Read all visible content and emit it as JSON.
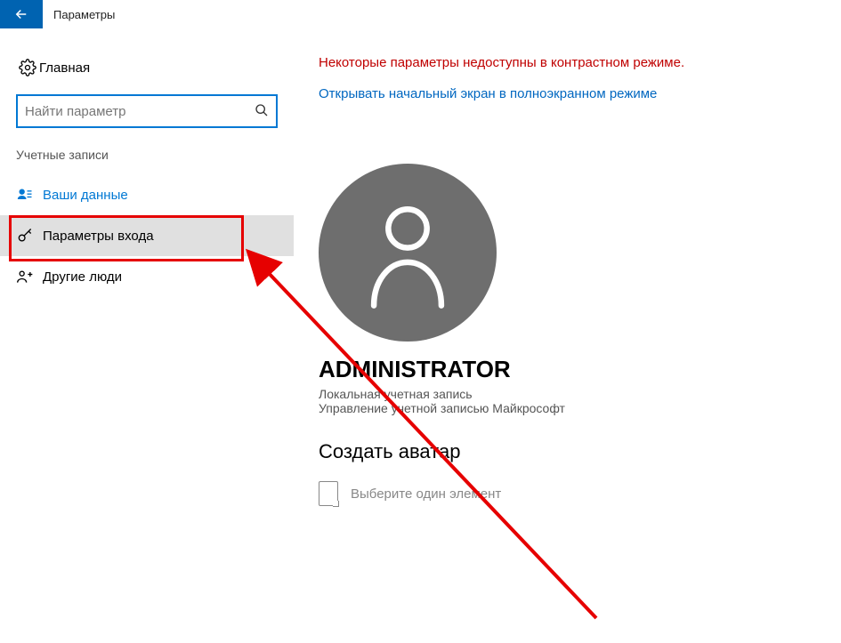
{
  "titlebar": {
    "title": "Параметры"
  },
  "sidebar": {
    "home": "Главная",
    "search_placeholder": "Найти параметр",
    "section": "Учетные записи",
    "items": [
      {
        "label": "Ваши данные"
      },
      {
        "label": "Параметры входа"
      },
      {
        "label": "Другие люди"
      }
    ]
  },
  "content": {
    "warning": "Некоторые параметры недоступны в контрастном режиме.",
    "fullscreen_link": "Открывать начальный экран в полноэкранном режиме",
    "user": {
      "name": "ADMINISTRATOR",
      "type": "Локальная учетная запись",
      "manage": "Управление учетной записью Майкрософт"
    },
    "avatar_section_title": "Создать аватар",
    "picker_hint": "Выберите один элемент"
  },
  "colors": {
    "accent": "#0063b1",
    "link": "#0067c0",
    "warning": "#c00000",
    "highlight": "#e60000"
  }
}
